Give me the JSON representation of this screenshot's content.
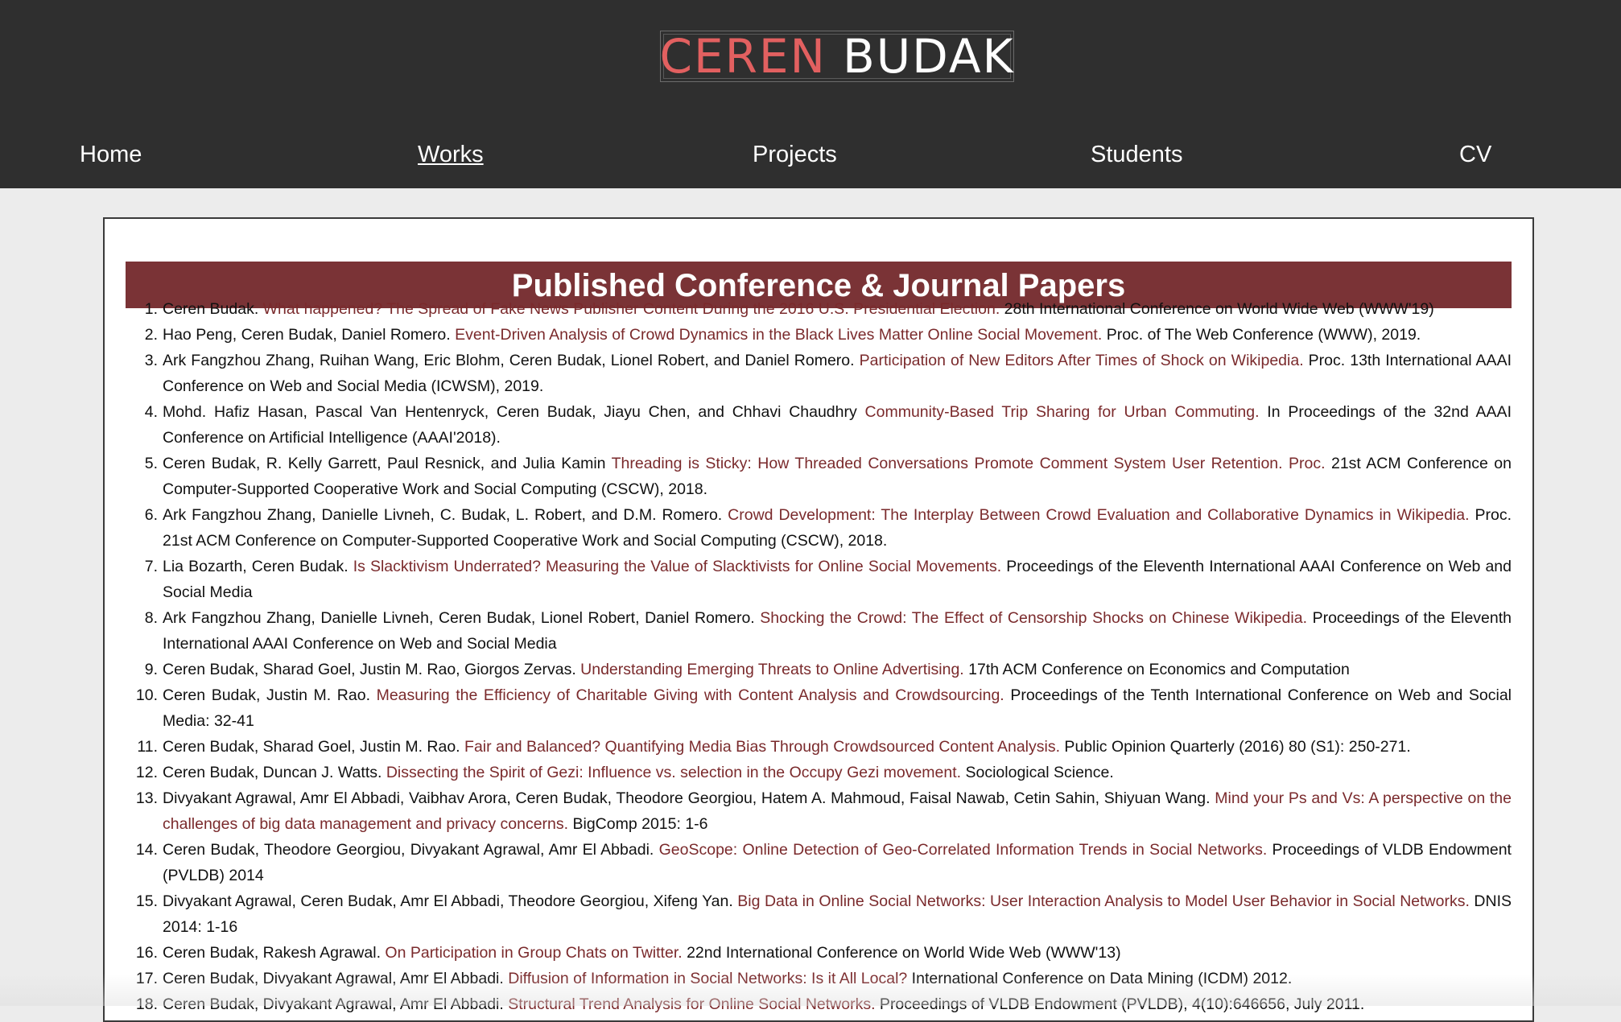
{
  "site": {
    "logo_first": "CEREN",
    "logo_last": "BUDAK",
    "colors": {
      "header_bg": "#2f2f2f",
      "logo_accent": "#e26060",
      "banner_bg": "#7a3336",
      "link": "#7a2a2c"
    }
  },
  "nav": {
    "items": [
      {
        "label": "Home",
        "active": false
      },
      {
        "label": "Works",
        "active": true
      },
      {
        "label": "Projects",
        "active": false
      },
      {
        "label": "Students",
        "active": false
      },
      {
        "label": "CV",
        "active": false
      }
    ]
  },
  "main": {
    "section_title": "Published Conference & Journal Papers",
    "papers": [
      {
        "num": "1.",
        "authors": "Ceren Budak. ",
        "title": "What happened? The Spread of Fake News Publisher Content During the 2016 U.S. Presidential Election.",
        "venue": " 28th International Conference on World Wide Web (WWW'19)"
      },
      {
        "num": "2.",
        "authors": "Hao Peng, Ceren Budak, Daniel Romero. ",
        "title": "Event-Driven Analysis of Crowd Dynamics in the Black Lives Matter Online Social Movement.",
        "venue": " Proc. of The Web Conference (WWW), 2019."
      },
      {
        "num": "3.",
        "authors": "Ark Fangzhou Zhang, Ruihan Wang, Eric Blohm, Ceren Budak, Lionel Robert, and Daniel Romero. ",
        "title": "Participation of New Editors After Times of Shock on Wikipedia.",
        "venue": " Proc. 13th International AAAI Conference on Web and Social Media (ICWSM), 2019."
      },
      {
        "num": "4.",
        "authors": "Mohd. Hafiz Hasan, Pascal Van Hentenryck, Ceren Budak, Jiayu Chen, and Chhavi Chaudhry ",
        "title": "Community-Based Trip Sharing for Urban Commuting.",
        "venue": " In Proceedings of the 32nd AAAI Conference on Artificial Intelligence (AAAI'2018)."
      },
      {
        "num": "5.",
        "authors": "Ceren Budak, R. Kelly Garrett, Paul Resnick, and Julia Kamin ",
        "title": "Threading is Sticky: How Threaded Conversations Promote Comment System User Retention. Proc.",
        "venue": " 21st ACM Conference on Computer-Supported Cooperative Work and Social Computing (CSCW), 2018."
      },
      {
        "num": "6.",
        "authors": "Ark Fangzhou Zhang, Danielle Livneh, C. Budak, L. Robert, and D.M. Romero. ",
        "title": "Crowd Development: The Interplay Between Crowd Evaluation and Collaborative Dynamics in Wikipedia.",
        "venue": " Proc. 21st ACM Conference on Computer-Supported Cooperative Work and Social Computing (CSCW), 2018."
      },
      {
        "num": "7.",
        "authors": "Lia Bozarth, Ceren Budak. ",
        "title": "Is Slacktivism Underrated? Measuring the Value of Slacktivists for Online Social Movements.",
        "venue": " Proceedings of the Eleventh International AAAI Conference on Web and Social Media"
      },
      {
        "num": "8.",
        "authors": "Ark Fangzhou Zhang, Danielle Livneh, Ceren Budak, Lionel Robert, Daniel Romero. ",
        "title": "Shocking the Crowd: The Effect of Censorship Shocks on Chinese Wikipedia.",
        "venue": " Proceedings of the Eleventh International AAAI Conference on Web and Social Media"
      },
      {
        "num": "9.",
        "authors": "Ceren Budak, Sharad Goel, Justin M. Rao, Giorgos Zervas. ",
        "title": "Understanding Emerging Threats to Online Advertising.",
        "venue": " 17th ACM Conference on Economics and Computation"
      },
      {
        "num": "10.",
        "authors": "Ceren Budak, Justin M. Rao. ",
        "title": "Measuring the Efficiency of Charitable Giving with Content Analysis and Crowdsourcing.",
        "venue": " Proceedings of the Tenth International Conference on Web and Social Media: 32-41"
      },
      {
        "num": "11.",
        "authors": "Ceren Budak, Sharad Goel, Justin M. Rao. ",
        "title": "Fair and Balanced? Quantifying Media Bias Through Crowdsourced Content Analysis.",
        "venue": " Public Opinion Quarterly (2016) 80 (S1): 250-271."
      },
      {
        "num": "12.",
        "authors": "Ceren Budak, Duncan J. Watts. ",
        "title": "Dissecting the Spirit of Gezi: Influence vs. selection in the Occupy Gezi movement.",
        "venue": " Sociological Science."
      },
      {
        "num": "13.",
        "authors": "Divyakant Agrawal, Amr El Abbadi, Vaibhav Arora, Ceren Budak, Theodore Georgiou, Hatem A. Mahmoud, Faisal Nawab, Cetin Sahin, Shiyuan Wang. ",
        "title": "Mind your Ps and Vs: A perspective on the challenges of big data management and privacy concerns.",
        "venue": " BigComp 2015: 1-6"
      },
      {
        "num": "14.",
        "authors": "Ceren Budak, Theodore Georgiou, Divyakant Agrawal, Amr El Abbadi. ",
        "title": "GeoScope: Online Detection of Geo-Correlated Information Trends in Social Networks.",
        "venue": " Proceedings of VLDB Endowment (PVLDB) 2014"
      },
      {
        "num": "15.",
        "authors": "Divyakant Agrawal, Ceren Budak, Amr El Abbadi, Theodore Georgiou, Xifeng Yan. ",
        "title": "Big Data in Online Social Networks: User Interaction Analysis to Model User Behavior in Social Networks.",
        "venue": " DNIS 2014: 1-16"
      },
      {
        "num": "16.",
        "authors": "Ceren Budak, Rakesh Agrawal. ",
        "title": "On Participation in Group Chats on Twitter.",
        "venue": " 22nd International Conference on World Wide Web (WWW'13)"
      },
      {
        "num": "17.",
        "authors": "Ceren Budak, Divyakant Agrawal, Amr El Abbadi. ",
        "title": "Diffusion of Information in Social Networks: Is it All Local?",
        "venue": " International Conference on Data Mining (ICDM) 2012."
      },
      {
        "num": "18.",
        "authors": "Ceren Budak, Divyakant Agrawal, Amr El Abbadi. ",
        "title": "Structural Trend Analysis for Online Social Networks.",
        "venue": " Proceedings of VLDB Endowment (PVLDB), 4(10):646656, July 2011."
      }
    ]
  }
}
